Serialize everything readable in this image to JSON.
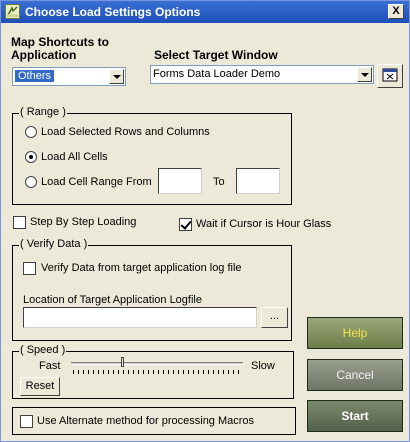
{
  "window": {
    "title": "Choose Load Settings Options",
    "close_glyph": "X",
    "icon": "app-icon"
  },
  "shortcuts": {
    "label_line1": "Map Shortcuts to",
    "label_line2": "Application",
    "selected": "Others"
  },
  "target": {
    "label": "Select Target Window",
    "selected": "Forms Data Loader Demo",
    "pick_icon": "window-picker-icon"
  },
  "range": {
    "legend": "( Range )",
    "options": [
      {
        "label": "Load Selected Rows and Columns",
        "selected": false
      },
      {
        "label": "Load All Cells",
        "selected": true
      },
      {
        "label": "Load Cell Range From",
        "selected": false
      }
    ],
    "from_value": "",
    "to_label": "To",
    "to_value": ""
  },
  "options": {
    "step_by_step": {
      "label": "Step By Step Loading",
      "checked": false
    },
    "wait_hourglass": {
      "label": "Wait if Cursor is Hour Glass",
      "checked": true
    }
  },
  "verify": {
    "legend": "( Verify Data )",
    "checkbox_label": "Verify Data from target application log file",
    "checked": false,
    "logfile_label": "Location of Target Application Logfile",
    "logfile_value": "",
    "browse_label": "..."
  },
  "speed": {
    "legend": "( Speed )",
    "fast_label": "Fast",
    "slow_label": "Slow",
    "level": 0.3,
    "reset_label": "Reset"
  },
  "alternate": {
    "label": "Use Alternate method for processing Macros",
    "checked": false
  },
  "buttons": {
    "help": "Help",
    "cancel": "Cancel",
    "start": "Start"
  }
}
